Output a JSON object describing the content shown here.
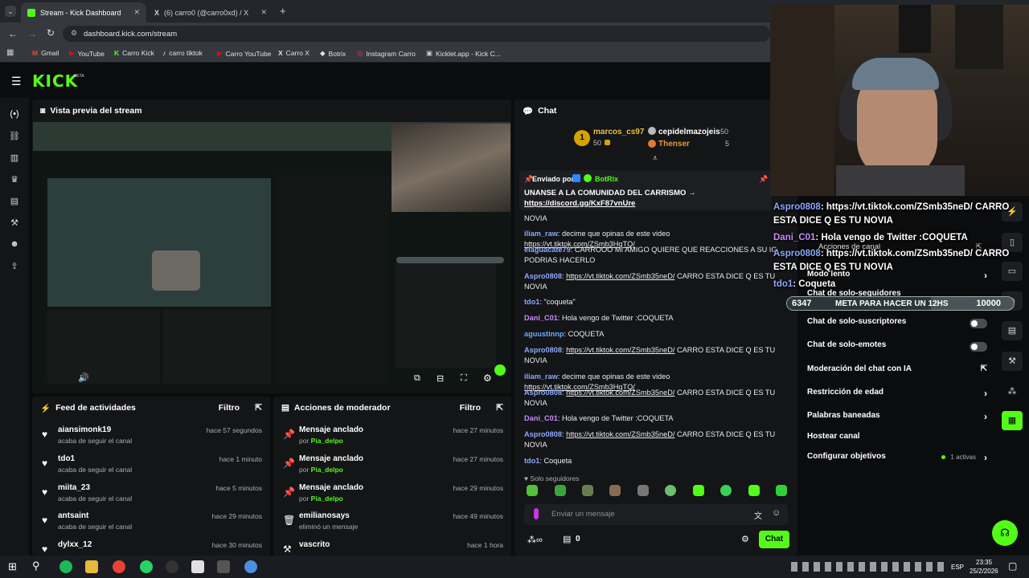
{
  "browser": {
    "tabs": [
      {
        "title": "Stream - Kick Dashboard",
        "active": true
      },
      {
        "title": "(6) carro0 (@carro0xd) / X",
        "active": false
      }
    ],
    "url": "dashboard.kick.com/stream",
    "bookmarks": [
      "Gmail",
      "YouTube",
      "Carro Kick",
      "carro tiktok",
      "Carro YouTube",
      "Carro X",
      "Botrix",
      "Instagram Carro",
      "Kicklet.app - Kick C..."
    ]
  },
  "kick": {
    "logo": "KICK",
    "beta": "BETA"
  },
  "preview": {
    "title": "Vista previa del stream"
  },
  "feed": {
    "title": "Feed de actividades",
    "filter": "Filtro",
    "items": [
      {
        "user": "aiansimonk19",
        "action": "acaba de seguir el canal",
        "time": "hace 57 segundos"
      },
      {
        "user": "tdo1",
        "action": "acaba de seguir el canal",
        "time": "hace 1 minuto"
      },
      {
        "user": "miita_23",
        "action": "acaba de seguir el canal",
        "time": "hace 5 minutos"
      },
      {
        "user": "antsaint",
        "action": "acaba de seguir el canal",
        "time": "hace 29 minutos"
      },
      {
        "user": "dylxx_12",
        "action": "",
        "time": "hace 30 minutos"
      }
    ]
  },
  "modactions": {
    "title": "Acciones de moderador",
    "filter": "Filtro",
    "items": [
      {
        "action": "Mensaje anclado",
        "by_prefix": "por",
        "by": "Pia_delpo",
        "time": "hace 27 minutos",
        "icon": "pin-icon"
      },
      {
        "action": "Mensaje anclado",
        "by_prefix": "por",
        "by": "Pia_delpo",
        "time": "hace 27 minutos",
        "icon": "pin-icon"
      },
      {
        "action": "Mensaje anclado",
        "by_prefix": "por",
        "by": "Pia_delpo",
        "time": "hace 29 minutos",
        "icon": "pin-icon"
      },
      {
        "action": "emilianosays",
        "by_prefix": "",
        "by": "eliminó un mensaje",
        "time": "hace 49 minutos",
        "icon": "trash-icon"
      },
      {
        "action": "vascrito",
        "by_prefix": "",
        "by": "",
        "time": "hace 1 hora",
        "icon": "hammer-icon"
      }
    ]
  },
  "chat": {
    "title": "Chat",
    "leaderboard": {
      "first": {
        "rank": "1",
        "user": "marcos_cs97",
        "points": "50"
      },
      "second": {
        "user": "cepidelmazojeis",
        "points": "50"
      },
      "third": {
        "user": "Thenser",
        "points": "5"
      }
    },
    "pinned": {
      "label": "Enviado por",
      "bot": "BotRix",
      "text": "UNANSE A LA COMUNIDAD DEL CARRISMO →",
      "link": "https://discord.gg/KxF87vnUre"
    },
    "messages": [
      {
        "user": "",
        "text": "NOVIA",
        "link": "",
        "color": "#e9ecef"
      },
      {
        "user": "iliam_raw",
        "text": "decime que opinas de este video",
        "link": "https://vt.tiktok.com/ZSmb3HqTQ/",
        "color": "#8aa9ff"
      },
      {
        "user": "elaguacate79",
        "text": "CARROOO MI AMIGO QUIERE QUE REACCIONES A SU IG PODRIAS HACERLO",
        "link": "",
        "color": "#8aa9ff"
      },
      {
        "user": "Aspro0808",
        "text": "CARRO ESTA DICE Q ES TU NOVIA",
        "link": "https://vt.tiktok.com/ZSmb35neD/",
        "color": "#8aa9ff"
      },
      {
        "user": "tdo1",
        "text": "\"coqueta\"",
        "link": "",
        "color": "#8aa9ff"
      },
      {
        "user": "Dani_C01",
        "text": "Hola vengo de Twitter :COQUETA",
        "link": "",
        "color": "#c58cff"
      },
      {
        "user": "aguustinnp",
        "text": "COQUETA",
        "link": "",
        "color": "#6fa8ff"
      },
      {
        "user": "Aspro0808",
        "text": "CARRO ESTA DICE Q ES TU NOVIA",
        "link": "https://vt.tiktok.com/ZSmb35neD/",
        "color": "#8aa9ff"
      },
      {
        "user": "iliam_raw",
        "text": "decime que opinas de este video",
        "link": "https://vt.tiktok.com/ZSmb3HqTQ/",
        "color": "#8aa9ff"
      },
      {
        "user": "Aspro0808",
        "text": "CARRO ESTA DICE Q ES TU NOVIA",
        "link": "https://vt.tiktok.com/ZSmb35neD/",
        "color": "#8aa9ff"
      },
      {
        "user": "Dani_C01",
        "text": "Hola vengo de Twitter :COQUETA",
        "link": "",
        "color": "#c58cff"
      },
      {
        "user": "Aspro0808",
        "text": "CARRO ESTA DICE Q ES TU NOVIA",
        "link": "https://vt.tiktok.com/ZSmb35neD/",
        "color": "#8aa9ff"
      },
      {
        "user": "tdo1",
        "text": "Coqueta",
        "link": "",
        "color": "#8aa9ff"
      }
    ],
    "followers_only": "Solo seguidores",
    "placeholder": "Enviar un mensaje",
    "count": "0",
    "send": "Chat"
  },
  "modsettings": {
    "items": [
      {
        "label": "Modo lento",
        "control": "arrow"
      },
      {
        "label": "Chat de solo-seguidores",
        "control": "toggle"
      },
      {
        "label": "Chat de solo-suscriptores",
        "control": "toggle"
      },
      {
        "label": "Chat de solo-emotes",
        "control": "toggle"
      },
      {
        "label": "Moderación del chat con IA",
        "control": "external"
      },
      {
        "label": "Restricción de edad",
        "control": "arrow"
      },
      {
        "label": "Palabras baneadas",
        "control": "arrow"
      },
      {
        "label": "Hostear canal",
        "control": "none"
      },
      {
        "label": "Configurar objetivos",
        "control": "arrow",
        "badge": "1 activas"
      }
    ],
    "overlay_header": "Acciones de canal"
  },
  "overlay": {
    "lines": [
      {
        "user": "Aspro0808",
        "text": ": https://vt.tiktok.com/ZSmb35neD/ CARRO"
      },
      {
        "user": "",
        "text": "ESTA DICE Q ES TU NOVIA"
      },
      {
        "user": "Dani_C01",
        "text": ": Hola vengo de Twitter :COQUETA"
      },
      {
        "user": "Aspro0808",
        "text": ": https://vt.tiktok.com/ZSmb35neD/ CARRO"
      },
      {
        "user": "",
        "text": "ESTA DICE Q ES TU NOVIA"
      },
      {
        "user": "tdo1",
        "text": ": Coqueta"
      }
    ],
    "goal": {
      "current": "6347",
      "label": "META PARA HACER UN 12HS",
      "target": "10000"
    }
  },
  "taskbar": {
    "lang": "ESP",
    "time": "23:35",
    "date": "25/2/2026"
  }
}
